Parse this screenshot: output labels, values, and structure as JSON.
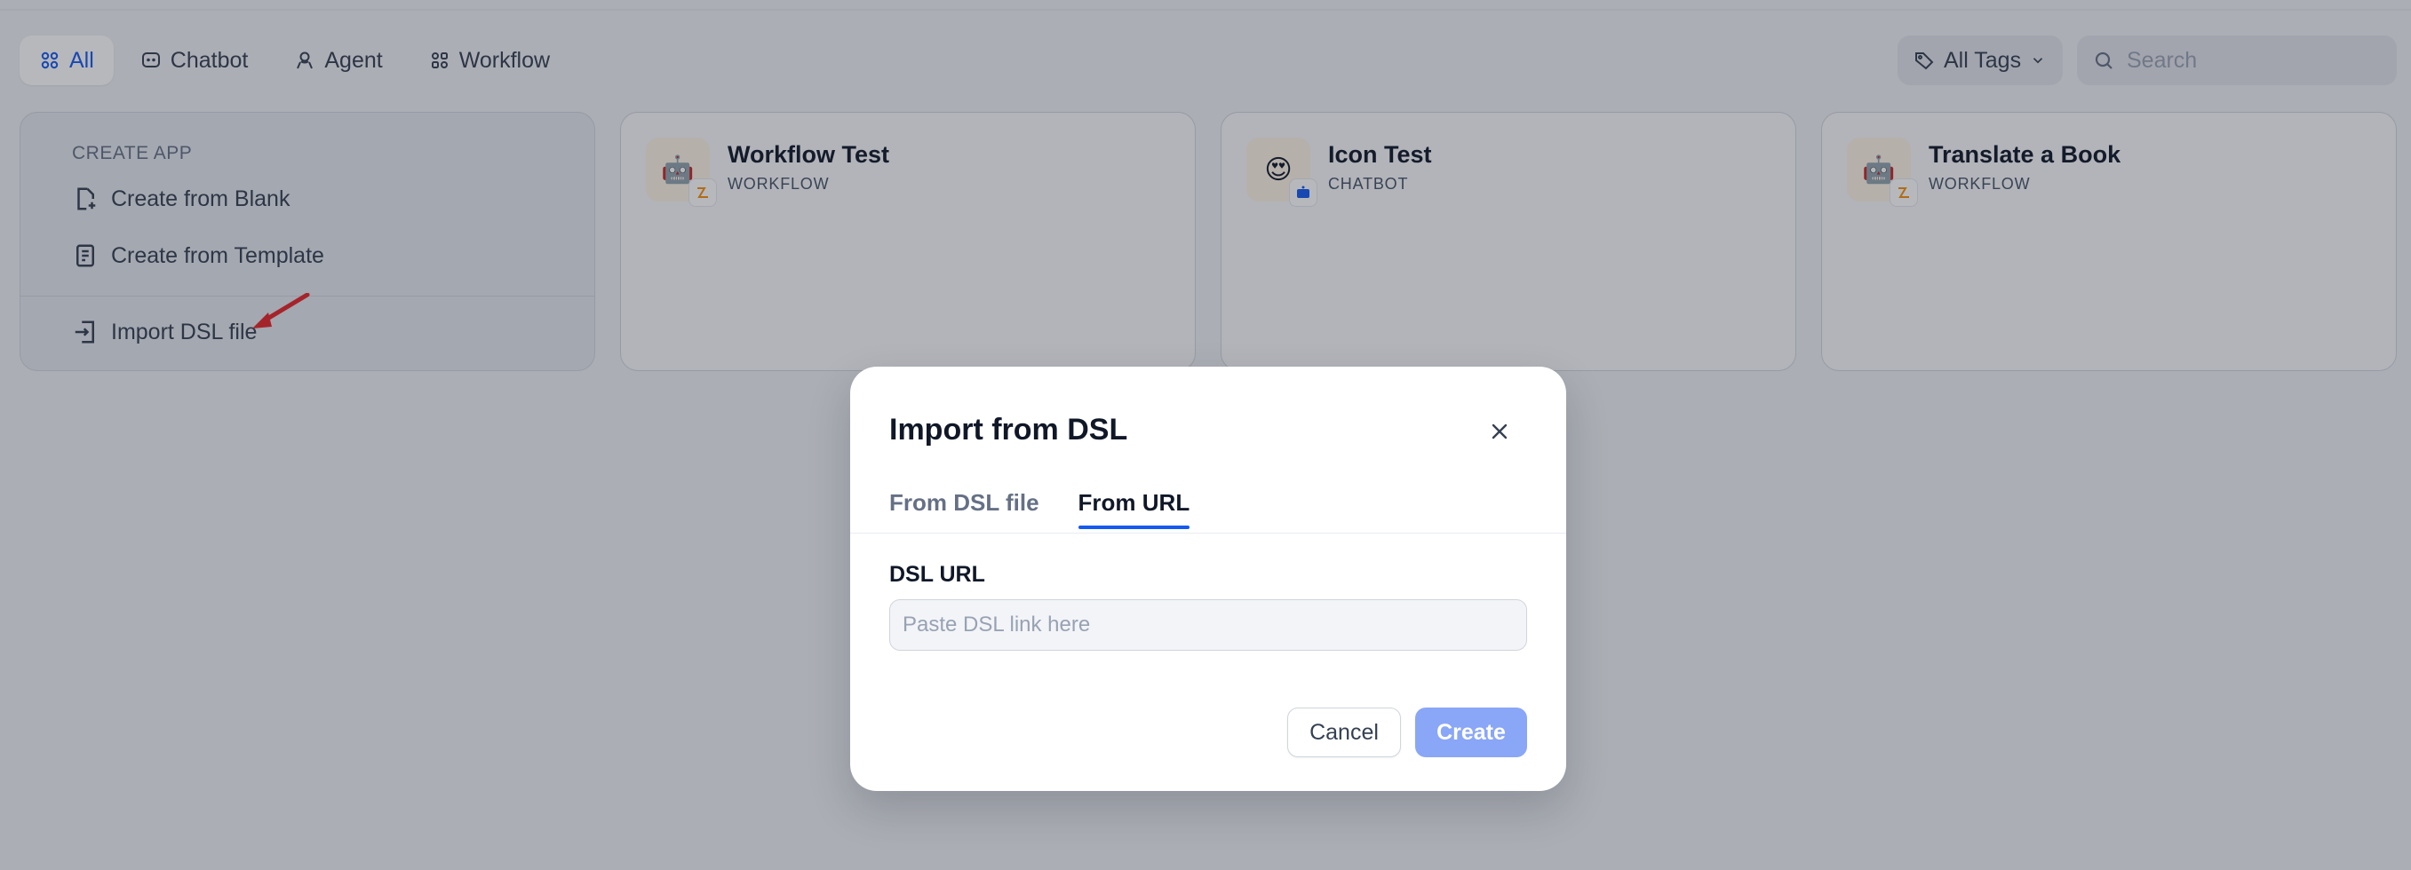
{
  "toolbar": {
    "tabs": [
      {
        "label": "All",
        "icon": "grid-icon",
        "active": true
      },
      {
        "label": "Chatbot",
        "icon": "chat-icon",
        "active": false
      },
      {
        "label": "Agent",
        "icon": "agent-icon",
        "active": false
      },
      {
        "label": "Workflow",
        "icon": "workflow-icon",
        "active": false
      }
    ],
    "tags_label": "All Tags",
    "search_placeholder": "Search"
  },
  "create_card": {
    "label": "CREATE APP",
    "items": [
      {
        "label": "Create from Blank",
        "icon": "file-plus-icon"
      },
      {
        "label": "Create from Template",
        "icon": "template-icon"
      },
      {
        "label": "Import DSL file",
        "icon": "import-icon"
      }
    ]
  },
  "apps": [
    {
      "name": "Workflow Test",
      "type": "WORKFLOW",
      "icon": "🤖",
      "badge": "workflow-badge-icon"
    },
    {
      "name": "Icon Test",
      "type": "CHATBOT",
      "icon": "😍",
      "badge": "chatbot-badge-icon"
    },
    {
      "name": "Translate a Book",
      "type": "WORKFLOW",
      "icon": "🤖",
      "badge": "workflow-badge-icon"
    }
  ],
  "modal": {
    "title": "Import from DSL",
    "tabs": [
      {
        "label": "From DSL file",
        "active": false
      },
      {
        "label": "From URL",
        "active": true
      }
    ],
    "field_label": "DSL URL",
    "input_value": "",
    "input_placeholder": "Paste DSL link here",
    "cancel_label": "Cancel",
    "create_label": "Create"
  },
  "colors": {
    "accent": "#155aef",
    "create_button_disabled": "#8aa6f6",
    "annotation_arrow": "#e5252a"
  }
}
